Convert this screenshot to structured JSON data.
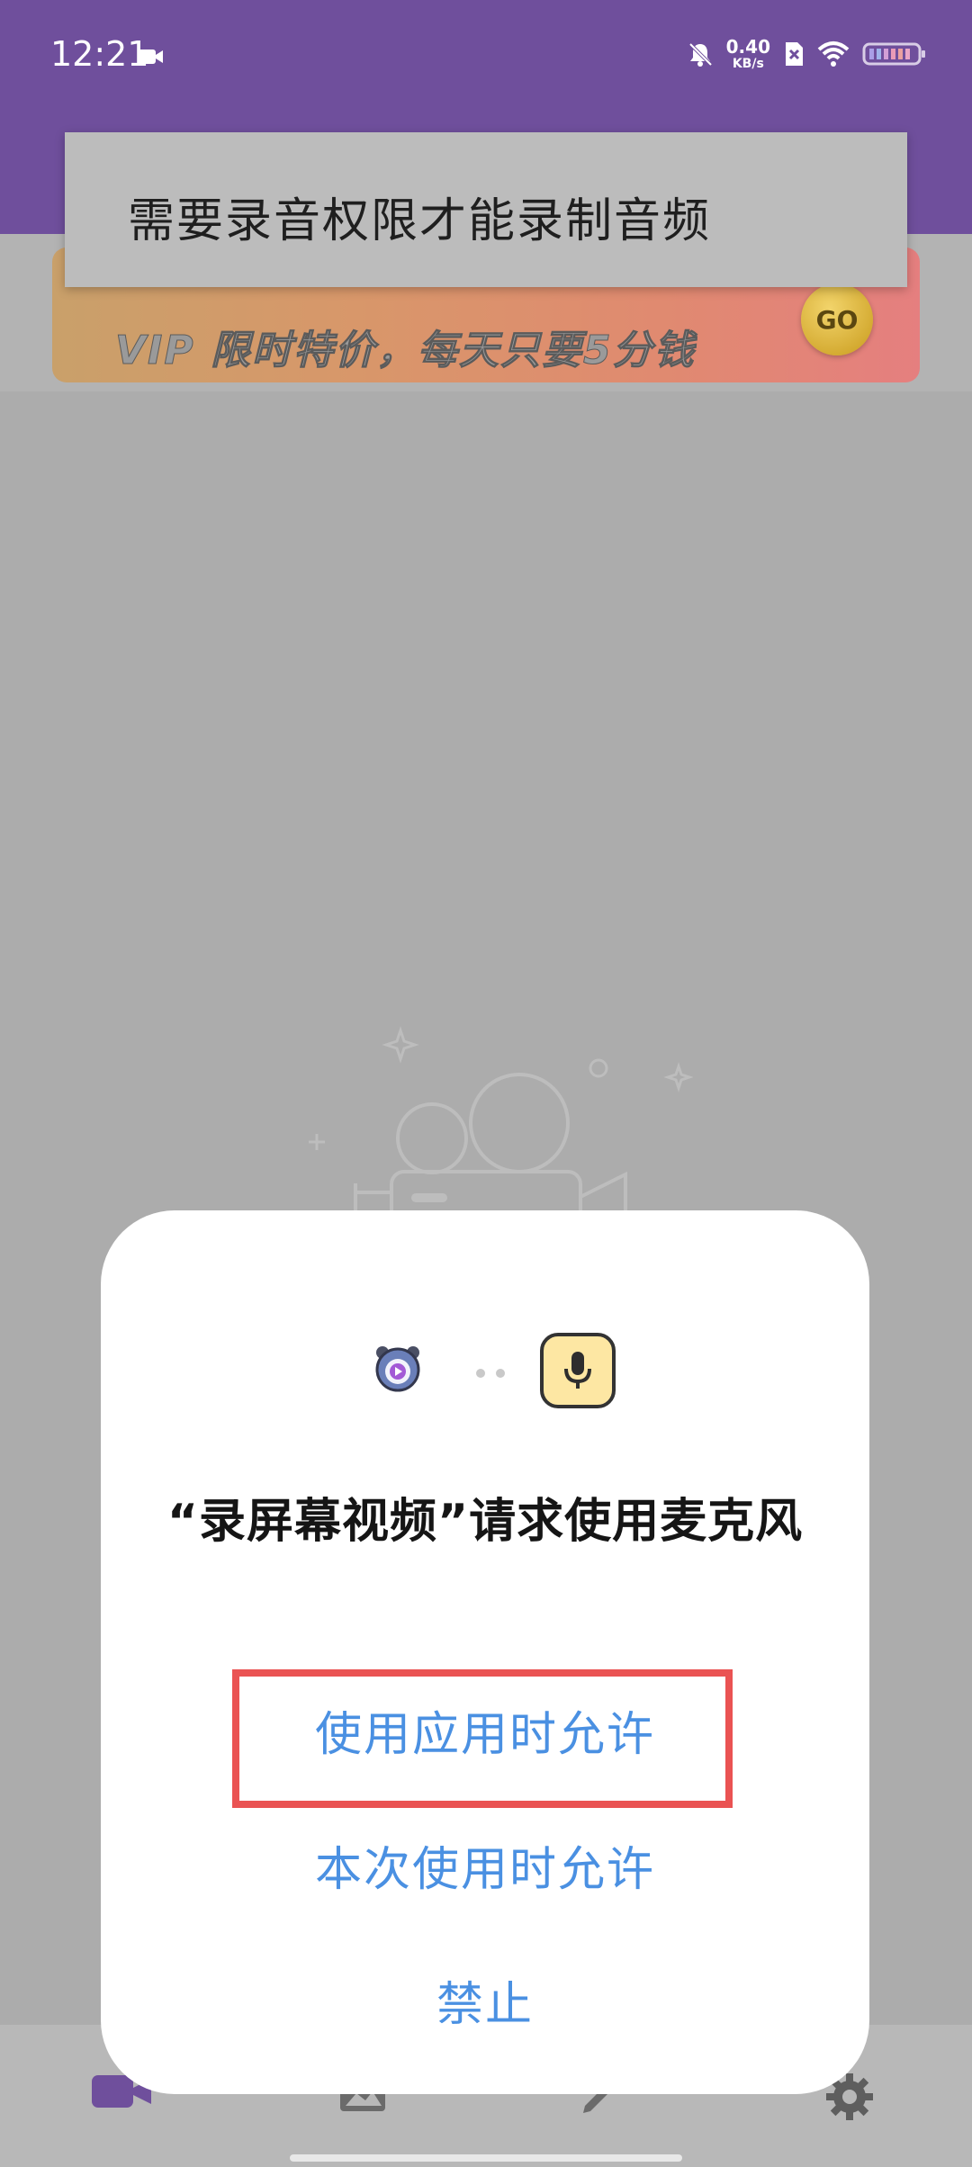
{
  "status_bar": {
    "time": "12:21",
    "net_speed_value": "0.40",
    "net_speed_unit": "KB/s",
    "icons": [
      "screen-record-icon",
      "mute-icon",
      "sim-disabled-icon",
      "wifi-icon",
      "battery-icon"
    ]
  },
  "toast": {
    "text": "需要录音权限才能录制音频"
  },
  "banner": {
    "text": "VIP 限时特价，每天只要5分钱",
    "go_label": "GO"
  },
  "dialog": {
    "title": "“录屏幕视频”请求使用麦克风",
    "buttons": {
      "allow_while_using": "使用应用时允许",
      "allow_this_time": "本次使用时允许",
      "deny": "禁止"
    }
  },
  "bottom_nav": {
    "items": [
      "record-tab-icon",
      "gallery-tab-icon",
      "edit-tab-icon",
      "settings-tab-icon"
    ]
  },
  "colors": {
    "status_bar": "#6f4f9c",
    "accent": "#4a90e2",
    "highlight": "#ea5353",
    "nav_active": "#6f4f9c"
  }
}
